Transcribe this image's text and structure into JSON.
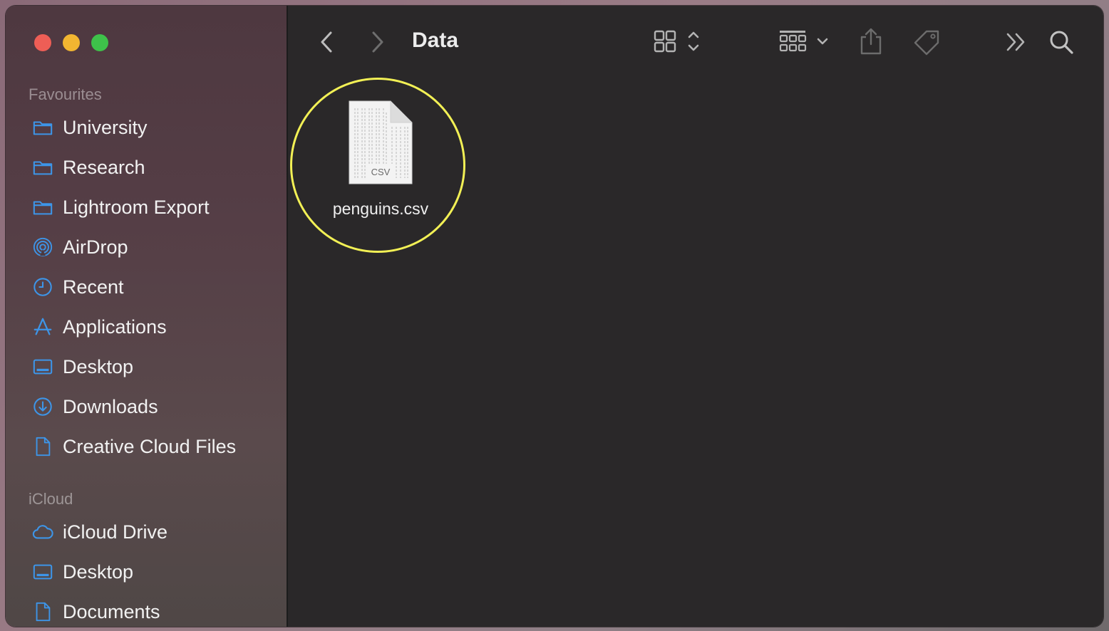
{
  "window": {
    "title": "Data"
  },
  "sidebar": {
    "sections": [
      {
        "label": "Favourites",
        "items": [
          {
            "label": "University",
            "icon": "folder-icon"
          },
          {
            "label": "Research",
            "icon": "folder-icon"
          },
          {
            "label": "Lightroom Export",
            "icon": "folder-icon"
          },
          {
            "label": "AirDrop",
            "icon": "airdrop-icon"
          },
          {
            "label": "Recent",
            "icon": "clock-icon"
          },
          {
            "label": "Applications",
            "icon": "applications-icon"
          },
          {
            "label": "Desktop",
            "icon": "desktop-icon"
          },
          {
            "label": "Downloads",
            "icon": "download-icon"
          },
          {
            "label": "Creative Cloud Files",
            "icon": "document-icon"
          }
        ]
      },
      {
        "label": "iCloud",
        "items": [
          {
            "label": "iCloud Drive",
            "icon": "cloud-icon"
          },
          {
            "label": "Desktop",
            "icon": "desktop-icon"
          },
          {
            "label": "Documents",
            "icon": "document-icon"
          }
        ]
      }
    ]
  },
  "files": [
    {
      "name": "penguins.csv",
      "type_badge": "CSV"
    }
  ],
  "colors": {
    "accent": "#3d95e8",
    "highlight": "#f2f055",
    "main_bg": "#2a2829"
  }
}
